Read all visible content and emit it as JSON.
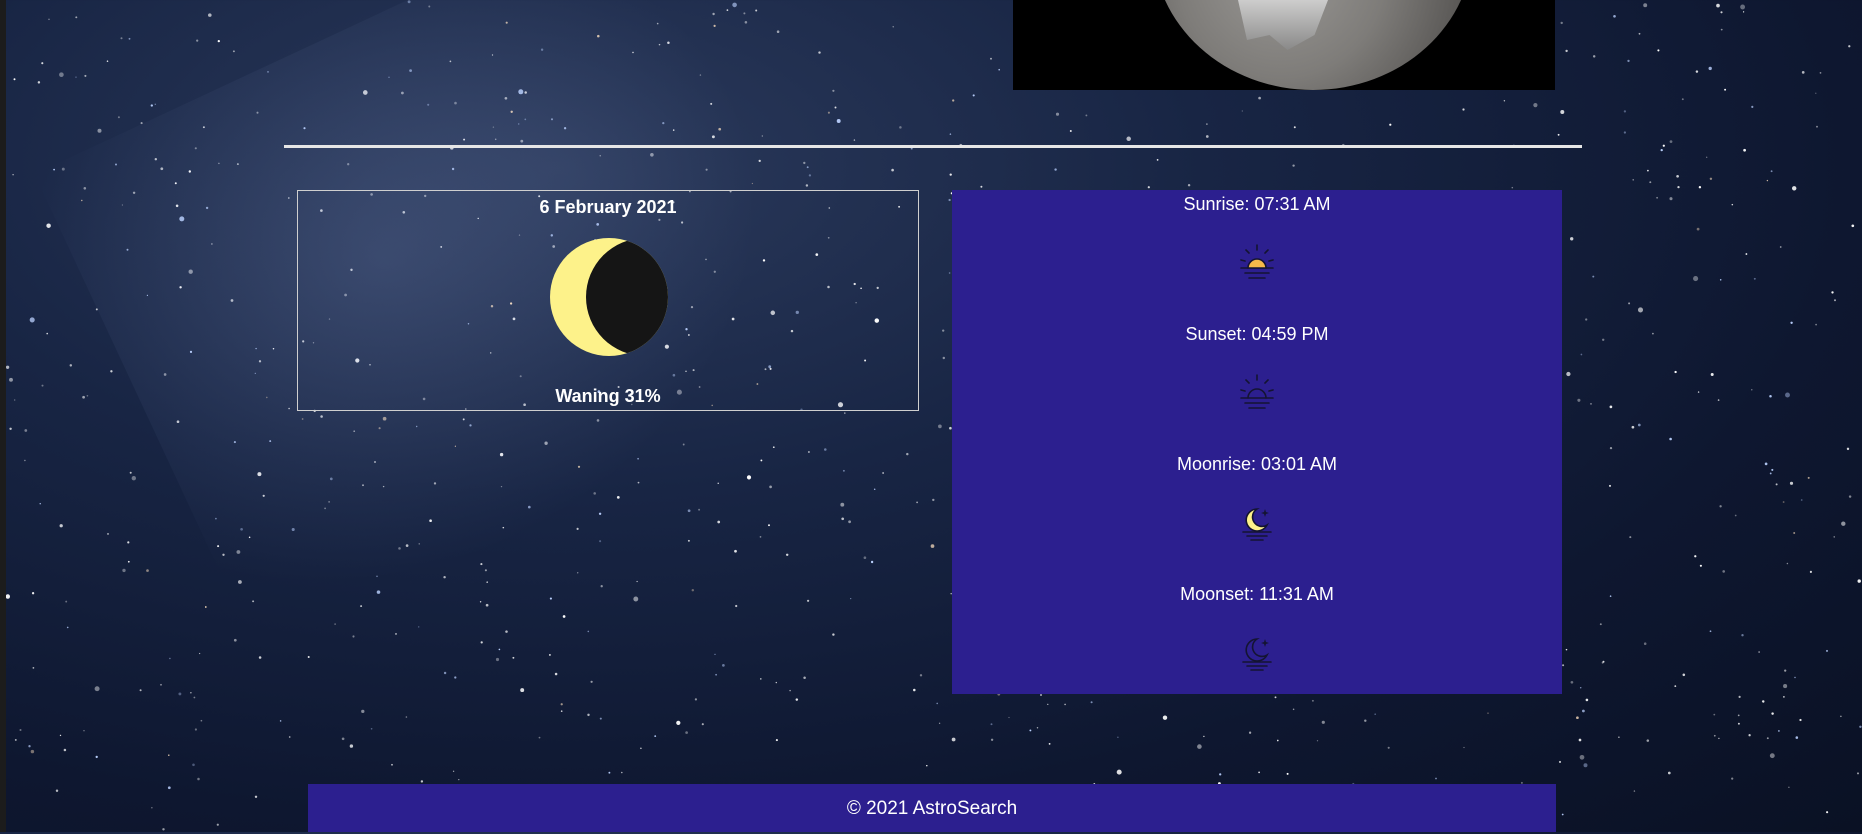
{
  "moon": {
    "date": "6 February 2021",
    "status": "Waning 31%",
    "illumination_fraction": 0.31
  },
  "times": {
    "sunrise": "Sunrise: 07:31 AM",
    "sunset": "Sunset: 04:59 PM",
    "moonrise": "Moonrise: 03:01 AM",
    "moonset": "Moonset: 11:31 AM"
  },
  "icons": [
    "sunrise-icon",
    "sunset-icon",
    "moonrise-icon",
    "moonset-icon"
  ],
  "footer": {
    "text": "© 2021 AstroSearch"
  },
  "colors": {
    "panel": "#2c1f8f",
    "moon_light": "#fdf28a",
    "sun": "#f5b94a",
    "icon_stroke": "#141432"
  }
}
